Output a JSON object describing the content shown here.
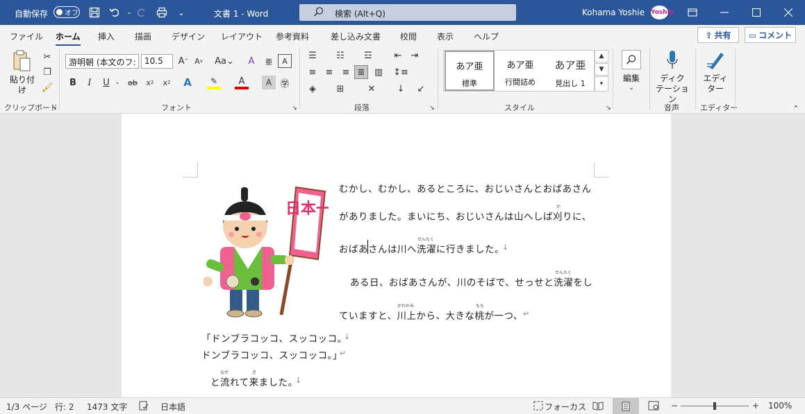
{
  "titlebar": {
    "autosave_label": "自動保存",
    "autosave_state": "オフ",
    "document_title": "文書 1 - Word",
    "search_placeholder": "検索 (Alt+Q)",
    "user_name": "Kohama Yoshie",
    "avatar_text": "Yoshie"
  },
  "tabs": [
    "ファイル",
    "ホーム",
    "挿入",
    "描画",
    "デザイン",
    "レイアウト",
    "参考資料",
    "差し込み文書",
    "校閲",
    "表示",
    "ヘルプ"
  ],
  "share_label": "共有",
  "comment_label": "コメント",
  "ribbon": {
    "clipboard": {
      "paste_label": "貼り付け",
      "group_label": "クリップボード"
    },
    "font": {
      "font_name": "游明朝 (本文のフ:",
      "font_size": "10.5",
      "group_label": "フォント"
    },
    "paragraph": {
      "group_label": "段落"
    },
    "styles": {
      "items": [
        {
          "preview": "あア亜",
          "name": "標準"
        },
        {
          "preview": "あア亜",
          "name": "行間詰め"
        },
        {
          "preview": "あア亜",
          "name": "見出し 1"
        }
      ],
      "group_label": "スタイル"
    },
    "editing_label": "編集",
    "dictate_label_1": "ディク",
    "dictate_label_2": "テーション",
    "voice_group_label": "音声",
    "editor_label_1": "エディ",
    "editor_label_2": "ター",
    "editor_group_label": "エディター"
  },
  "document": {
    "banner_text": "日本一",
    "lines": [
      "むかし、むかし、あるところに、おじいさんとおばあさん",
      "がありました。まいにち、おじいさんは山へしば刈りに、",
      "おばあさんは川へ洗濯に行きました。",
      "ある日、おばあさんが、川のそばで、せっせと洗濯をし",
      "ていますと、川上から、大きな桃が一つ、",
      "「ドンブラコッコ、スッコッコ。",
      "ドンブラコッコ、スッコッコ。」",
      "と流れて来ました。"
    ],
    "ruby": [
      "か",
      "せんたく",
      "せんたく",
      "かわかみ",
      "もも",
      "なが",
      "き"
    ]
  },
  "statusbar": {
    "page": "1/3 ページ",
    "line": "行: 2",
    "chars": "1473 文字",
    "language": "日本語",
    "focus": "フォーカス",
    "zoom": "100%"
  },
  "colors": {
    "accent": "#2b579a",
    "highlight": "#ffff00",
    "font_color": "#e00000"
  }
}
